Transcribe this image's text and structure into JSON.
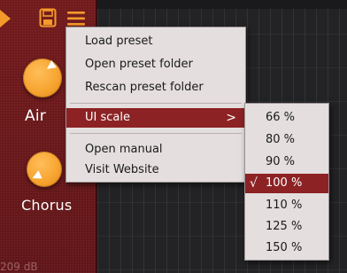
{
  "menu": {
    "items": [
      {
        "label": "Load preset"
      },
      {
        "label": "Open preset folder"
      },
      {
        "label": "Rescan preset folder"
      },
      {
        "label": "UI scale",
        "has_submenu": true,
        "highlighted": true
      },
      {
        "label": "Open manual"
      },
      {
        "label": "Visit Website"
      }
    ]
  },
  "submenu": {
    "items": [
      {
        "label": "66 %"
      },
      {
        "label": "80 %"
      },
      {
        "label": "90 %"
      },
      {
        "label": "100 %",
        "selected": true
      },
      {
        "label": "110 %"
      },
      {
        "label": "125 %"
      },
      {
        "label": "150 %"
      }
    ],
    "check_glyph": "√",
    "chevron_glyph": ">"
  },
  "panel": {
    "knobs": [
      {
        "label": "Air"
      },
      {
        "label": "Chorus"
      }
    ],
    "bottom_readout": "209 dB"
  },
  "icons": [
    "play-icon",
    "save-icon",
    "hamburger-menu-icon",
    "chevron-right-icon",
    "checkmark-icon"
  ],
  "colors": {
    "panel_bg": "#6a1518",
    "knob": "#f7a531",
    "menu_bg": "#e4dede",
    "highlight": "#8c2224",
    "grid_bg": "#232325"
  }
}
